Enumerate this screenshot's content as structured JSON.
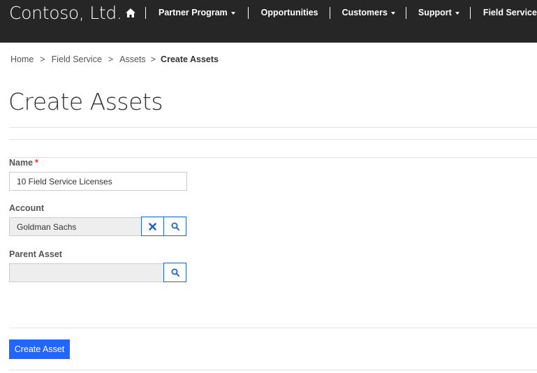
{
  "header": {
    "brand": "Contoso, Ltd.",
    "nav": [
      {
        "label": "Partner Program",
        "dropdown": true
      },
      {
        "label": "Opportunities",
        "dropdown": false
      },
      {
        "label": "Customers",
        "dropdown": true
      },
      {
        "label": "Support",
        "dropdown": true
      },
      {
        "label": "Field Service",
        "dropdown": true
      }
    ]
  },
  "breadcrumb": {
    "items": [
      "Home",
      "Field Service",
      "Assets"
    ],
    "separator": ">",
    "current": "Create Assets"
  },
  "page": {
    "title": "Create Assets"
  },
  "form": {
    "name": {
      "label": "Name",
      "required_mark": "*",
      "value": "10 Field Service Licenses"
    },
    "account": {
      "label": "Account",
      "value": "Goldman Sachs"
    },
    "parent_asset": {
      "label": "Parent Asset",
      "value": ""
    },
    "submit_label": "Create Asset"
  },
  "colors": {
    "topbar": "#262626",
    "primary_button": "#2266ff",
    "lookup_border": "#2266cc",
    "required": "#e0361f"
  }
}
